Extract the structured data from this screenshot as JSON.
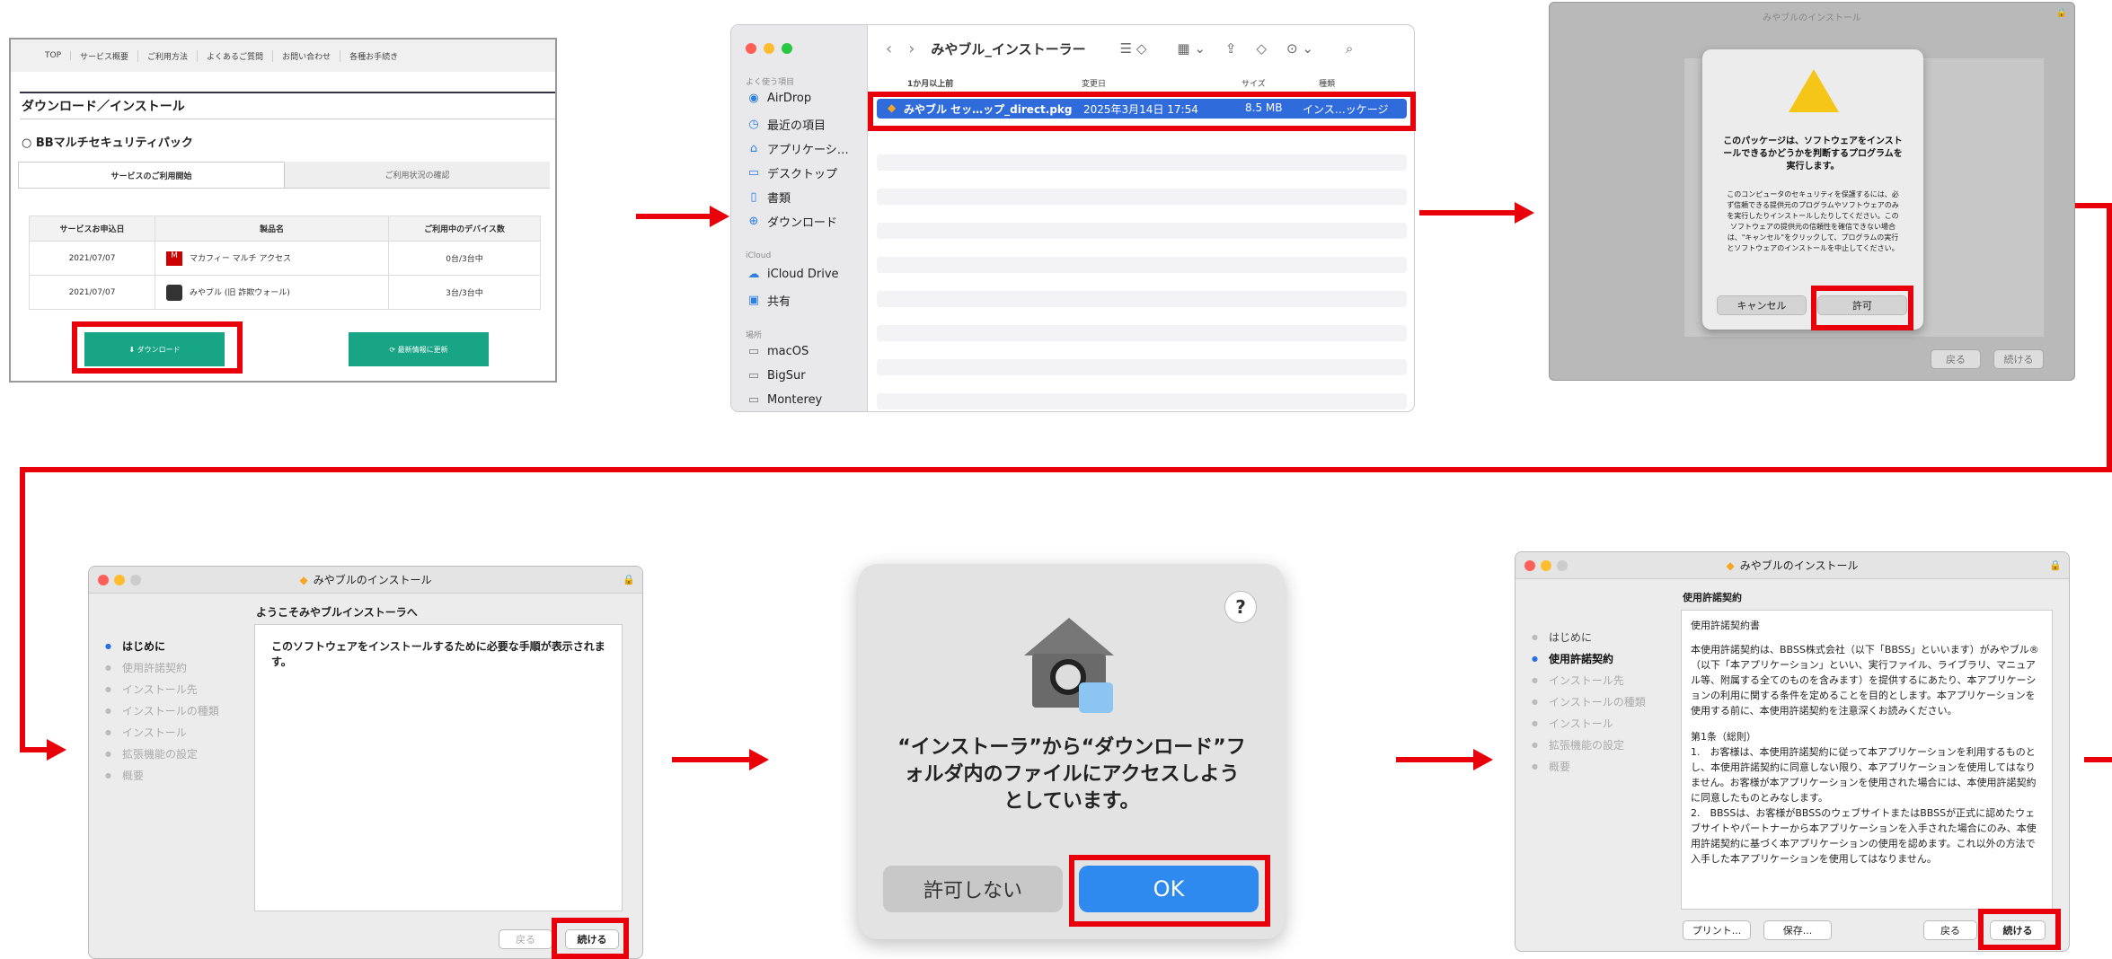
{
  "website": {
    "nav": [
      "TOP",
      "サービス概要",
      "ご利用方法",
      "よくあるご質問",
      "お問い合わせ",
      "各種お手続き"
    ],
    "heading": "ダウンロード／インストール",
    "subheading": "○ BBマルチセキュリティパック",
    "tabs": [
      "サービスのご利用開始",
      "ご利用状況の確認"
    ],
    "table_headers": [
      "サービスお申込日",
      "製品名",
      "ご利用中のデバイス数"
    ],
    "rows": [
      {
        "date": "2021/07/07",
        "product": "マカフィー マルチ アクセス",
        "devices": "0台/3台中"
      },
      {
        "date": "2021/07/07",
        "product": "みやブル (旧 詐欺ウォール)",
        "devices": "3台/3台中"
      }
    ],
    "download_button": "⬇ ダウンロード",
    "update_button": "⟳ 最新情報に更新",
    "mcafee_label": "McAfee"
  },
  "finder": {
    "folder": "みやブル_インストーラー",
    "sidebar_section_fav": "よく使う項目",
    "sidebar_fav": [
      {
        "icon": "◉",
        "label": "AirDrop"
      },
      {
        "icon": "◷",
        "label": "最近の項目"
      },
      {
        "icon": "⌂",
        "label": "アプリケーシ…"
      },
      {
        "icon": "▭",
        "label": "デスクトップ"
      },
      {
        "icon": "▯",
        "label": "書類"
      },
      {
        "icon": "⊕",
        "label": "ダウンロード"
      }
    ],
    "sidebar_section_icloud": "iCloud",
    "sidebar_icloud": [
      {
        "icon": "☁",
        "label": "iCloud Drive"
      },
      {
        "icon": "▣",
        "label": "共有"
      }
    ],
    "sidebar_section_places": "場所",
    "sidebar_places": [
      {
        "icon": "▭",
        "label": "macOS"
      },
      {
        "icon": "▭",
        "label": "BigSur"
      },
      {
        "icon": "▭",
        "label": "Monterey"
      }
    ],
    "col_headers": [
      "1か月以上前",
      "変更日",
      "サイズ",
      "種類"
    ],
    "file": {
      "name": "みやブル セッ…ップ_direct.pkg",
      "date": "2025年3月14日 17:54",
      "size": "8.5 MB",
      "kind": "インス…ッケージ"
    }
  },
  "installer_dialog": {
    "window_title": "みやブルのインストール",
    "heading": "このパッケージは、ソフトウェアをインストールできるかどうかを判断するプログラムを実行します。",
    "body": "このコンピュータのセキュリティを保護するには、必ず信頼できる提供元のプログラムやソフトウェアのみを実行したりインストールしたりしてください。このソフトウェアの提供元の信頼性を確信できない場合は、\"キャンセル\"をクリックして、プログラムの実行とソフトウェアのインストールを中止してください。",
    "cancel": "キャンセル",
    "allow": "許可",
    "back": "戻る",
    "continue": "続ける"
  },
  "installer_intro": {
    "title": "みやブルのインストール",
    "subtitle": "ようこそみやブルインストーラへ",
    "steps": [
      "はじめに",
      "使用許諾契約",
      "インストール先",
      "インストールの種類",
      "インストール",
      "拡張機能の設定",
      "概要"
    ],
    "body": "このソフトウェアをインストールするために必要な手順が表示されます。",
    "back": "戻る",
    "continue": "続ける"
  },
  "access_dialog": {
    "message": "“インストーラ”から“ダウンロード”フォルダ内のファイルにアクセスしようとしています。",
    "deny": "許可しない",
    "ok": "OK",
    "help": "?"
  },
  "installer_license": {
    "title": "みやブルのインストール",
    "subtitle": "使用許諾契約",
    "steps": [
      "はじめに",
      "使用許諾契約",
      "インストール先",
      "インストールの種類",
      "インストール",
      "拡張機能の設定",
      "概要"
    ],
    "doc_title": "使用許諾契約書",
    "para1": "本使用許諾契約は、BBSS株式会社（以下「BBSS」といいます）がみやブル®（以下「本アプリケーション」といい、実行ファイル、ライブラリ、マニュアル等、附属する全てのものを含みます）を提供するにあたり、本アプリケーションの利用に関する条件を定めることを目的とします。本アプリケーションを使用する前に、本使用許諾契約を注意深くお読みください。",
    "art_title": "第1条（総則）",
    "art1": "1.　お客様は、本使用許諾契約に従って本アプリケーションを利用するものとし、本使用許諾契約に同意しない限り、本アプリケーションを使用してはなりません。お客様が本アプリケーションを使用された場合には、本使用許諾契約に同意したものとみなします。",
    "art2": "2.　BBSSは、お客様がBBSSのウェブサイトまたはBBSSが正式に認めたウェブサイトやパートナーから本アプリケーションを入手された場合にのみ、本使用許諾契約に基づく本アプリケーションの使用を認めます。これ以外の方法で入手した本アプリケーションを使用してはなりません。",
    "print": "プリント...",
    "save": "保存...",
    "back": "戻る",
    "continue": "続ける"
  },
  "colors": {
    "highlight": "#e8000b",
    "teal": "#17a585",
    "mac_blue": "#2870e0"
  }
}
